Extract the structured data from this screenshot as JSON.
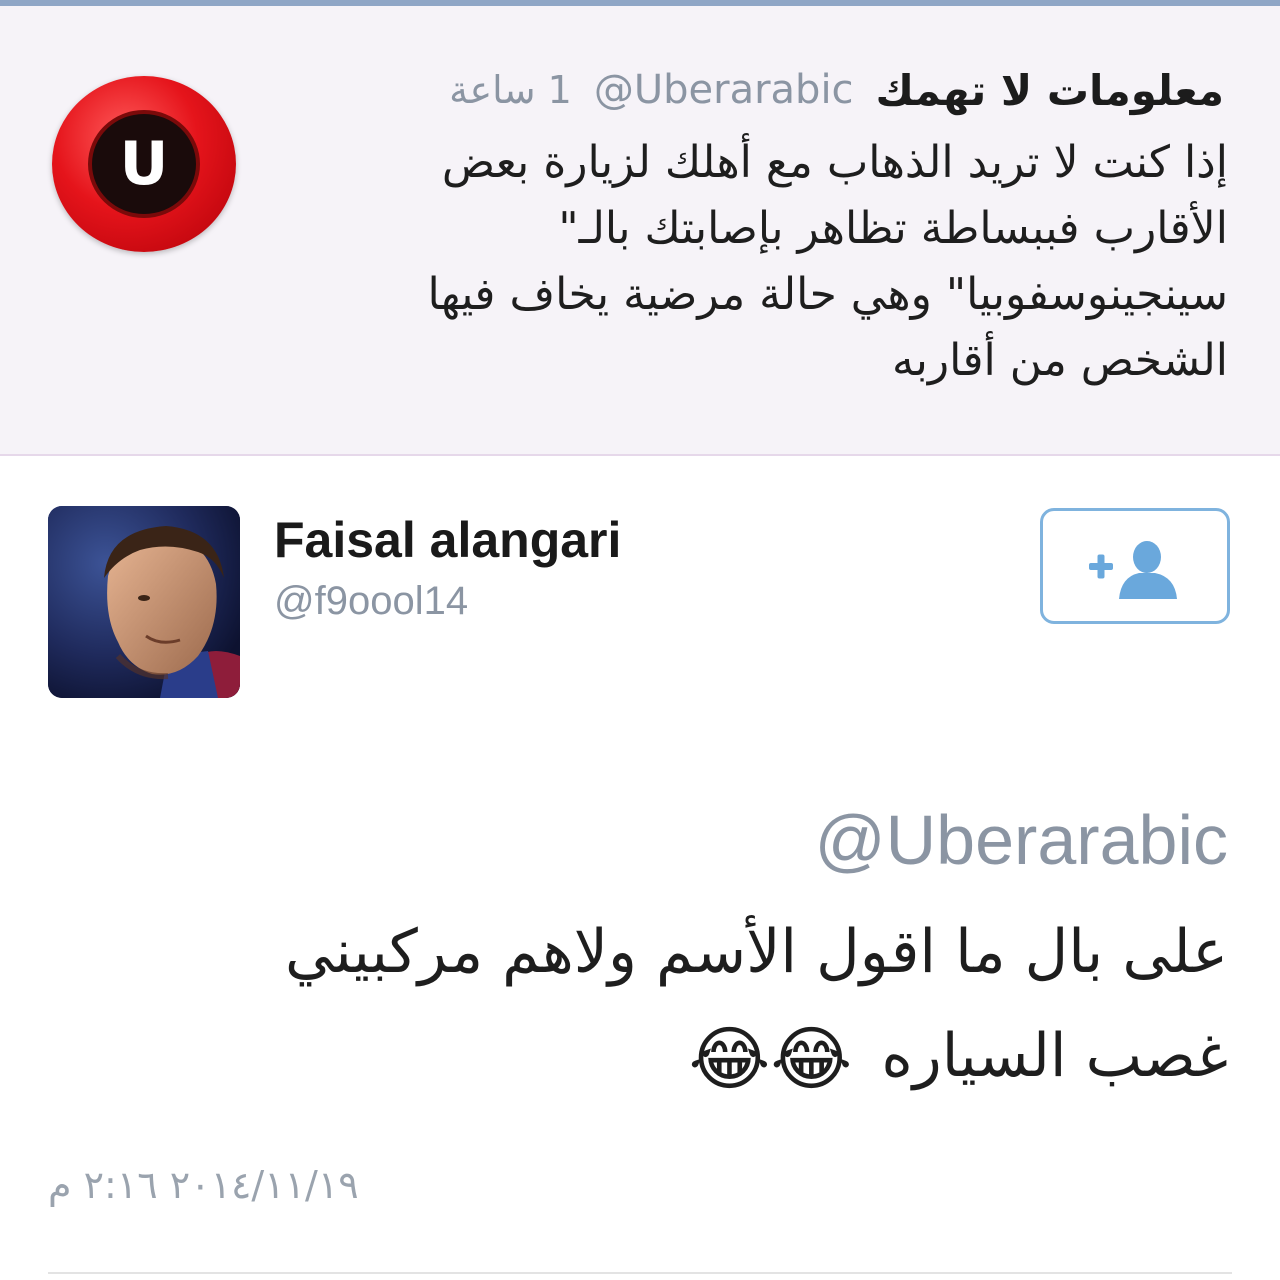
{
  "quoted_tweet": {
    "avatar_letter": "U",
    "display_name": "معلومات لا تهمك",
    "handle": "@Uberarabic",
    "time": "1 ساعة",
    "body_lines": [
      "إذا كنت لا تريد الذهاب مع أهلك لزيارة بعض",
      "الأقارب فببساطة تظاهر بإصابتك بالـ\"",
      "سينجينوسفوبيا\" وهي حالة مرضية يخاف فيها",
      "الشخص من أقاربه"
    ]
  },
  "reply_tweet": {
    "display_name": "Faisal alangari",
    "handle": "@f9oool14",
    "follow_icon": "add-user-icon",
    "mention": "@Uberarabic",
    "body_line_1": "على بال ما اقول الأسم ولاهم مركبيني",
    "body_line_2": "غصب السياره",
    "emojis": "😂😂",
    "timestamp": "٢٠١٤/١١/١٩ ٢:١٦ م"
  },
  "colors": {
    "top_bar": "#8fa6c6",
    "quoted_background": "#f6f3f8",
    "muted_text": "#8b95a3",
    "follow_border": "#7fb3de",
    "follow_icon": "#6aa8dc",
    "brand_red": "#e5141b"
  }
}
